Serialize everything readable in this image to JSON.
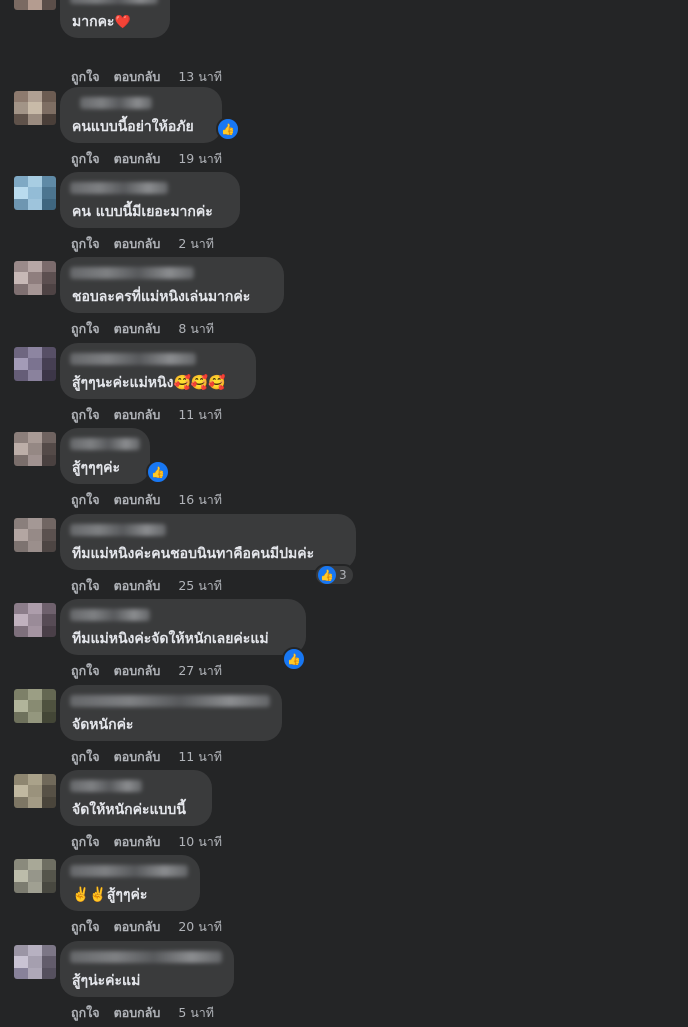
{
  "labels": {
    "like": "ถูกใจ",
    "reply": "ตอบกลับ"
  },
  "comments": [
    {
      "text": "มากคะ",
      "emoji": "❤️",
      "time": "13 นาที"
    },
    {
      "text": "คนแบบนี้อย่าให้อภัย",
      "time": "19 นาที",
      "reaction": "like"
    },
    {
      "text": "คน แบบนี้มีเยอะมากค่ะ",
      "time": "2 นาที"
    },
    {
      "text": "ชอบละครที่แม่หนิงเล่นมากค่ะ",
      "time": "8 นาที"
    },
    {
      "text": "สู้ๆๆนะค่ะแม่หนิง",
      "emoji": "🥰🥰🥰",
      "time": "11 นาที"
    },
    {
      "text": "สู้ๆๆๆค่ะ",
      "time": "16 นาที",
      "reaction": "like"
    },
    {
      "text": "ทีมแม่หนิงค่ะคนชอบนินทาคือคนมีปมค่ะ",
      "time": "25 นาที",
      "reaction": "like",
      "reaction_count": "3"
    },
    {
      "text": "ทีมแม่หนิงค่ะจัดให้หนักเลยค่ะแม่",
      "time": "27 นาที",
      "reaction": "like"
    },
    {
      "text": "จัดหนักค่ะ",
      "time": "11 นาที"
    },
    {
      "text": "จัดให้หนักค่ะแบบนี้",
      "time": "10 นาที"
    },
    {
      "text": "สู้ๆๆค่ะ",
      "emoji_prefix": "✌️✌️",
      "time": "20 นาที"
    },
    {
      "text": "สู้ๆน่ะค่ะแม่",
      "time": "5 นาที"
    }
  ]
}
